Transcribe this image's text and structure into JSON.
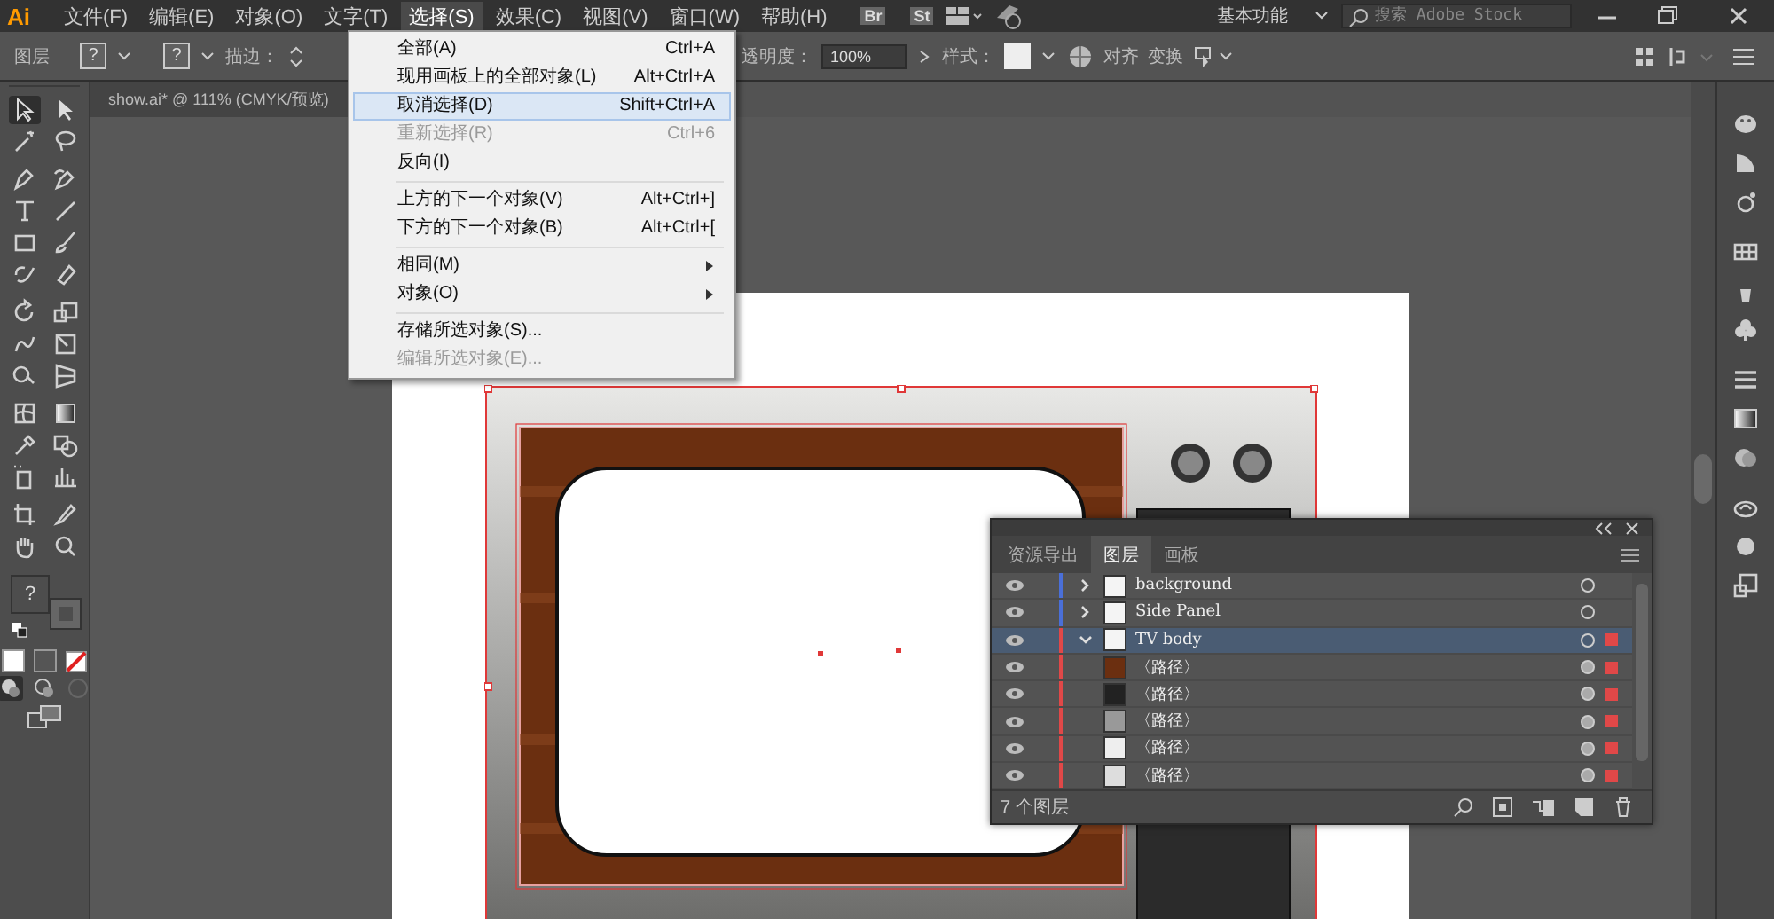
{
  "menu_bar": {
    "logo": "Ai",
    "items": [
      {
        "label": "文件(F)",
        "selected": false
      },
      {
        "label": "编辑(E)",
        "selected": false
      },
      {
        "label": "对象(O)",
        "selected": false
      },
      {
        "label": "文字(T)",
        "selected": false
      },
      {
        "label": "选择(S)",
        "selected": true
      },
      {
        "label": "效果(C)",
        "selected": false
      },
      {
        "label": "视图(V)",
        "selected": false
      },
      {
        "label": "窗口(W)",
        "selected": false
      },
      {
        "label": "帮助(H)",
        "selected": false
      }
    ],
    "bridge": "Br",
    "stock": "St",
    "workspace": "基本功能",
    "search": {
      "placeholder": "搜索 Adobe Stock"
    }
  },
  "control_bar": {
    "selection_label": "图层",
    "fill_swatch": "?",
    "stroke_swatch": "?",
    "stroke_label": "描边：",
    "opacity_label": "透明度：",
    "opacity": "100%",
    "style_label": "样式：",
    "align": "对齐",
    "transform": "变换"
  },
  "document_tab": {
    "title": "show.ai* @ 111% (CMYK/预览)"
  },
  "select_menu": {
    "groups": [
      [
        {
          "label": "全部(A)",
          "shortcut": "Ctrl+A",
          "disabled": false,
          "submenu": false,
          "selected": false
        },
        {
          "label": "现用画板上的全部对象(L)",
          "shortcut": "Alt+Ctrl+A",
          "disabled": false,
          "submenu": false,
          "selected": false
        },
        {
          "label": "取消选择(D)",
          "shortcut": "Shift+Ctrl+A",
          "disabled": false,
          "submenu": false,
          "selected": true
        },
        {
          "label": "重新选择(R)",
          "shortcut": "Ctrl+6",
          "disabled": true,
          "submenu": false,
          "selected": false
        },
        {
          "label": "反向(I)",
          "disabled": false,
          "submenu": false,
          "selected": false
        }
      ],
      [
        {
          "label": "上方的下一个对象(V)",
          "shortcut": "Alt+Ctrl+]",
          "disabled": false,
          "submenu": false,
          "selected": false
        },
        {
          "label": "下方的下一个对象(B)",
          "shortcut": "Alt+Ctrl+[",
          "disabled": false,
          "submenu": false,
          "selected": false
        }
      ],
      [
        {
          "label": "相同(M)",
          "disabled": false,
          "submenu": true,
          "selected": false
        },
        {
          "label": "对象(O)",
          "disabled": false,
          "submenu": true,
          "selected": false
        }
      ],
      [
        {
          "label": "存储所选对象(S)...",
          "disabled": false,
          "submenu": false,
          "selected": false
        },
        {
          "label": "编辑所选对象(E)...",
          "disabled": true,
          "submenu": false,
          "selected": false
        }
      ]
    ]
  },
  "toolbar": {
    "fill_swatch": "?"
  },
  "layers_panel": {
    "tabs": [
      {
        "label": "资源导出",
        "selected": false
      },
      {
        "label": "图层",
        "selected": true
      },
      {
        "label": "画板",
        "selected": false
      }
    ],
    "layers": [
      {
        "name": "background",
        "color": "#4a6fd8",
        "expanded": false,
        "selected": false,
        "art_selected": false
      },
      {
        "name": "Side Panel",
        "color": "#4a6fd8",
        "expanded": false,
        "selected": false,
        "art_selected": false
      },
      {
        "name": "TV body",
        "color": "#e04848",
        "expanded": true,
        "selected": true,
        "art_selected": true,
        "children": [
          {
            "name": "〈路径〉",
            "art_selected": true
          },
          {
            "name": "〈路径〉",
            "art_selected": true
          },
          {
            "name": "〈路径〉",
            "art_selected": true
          },
          {
            "name": "〈路径〉",
            "art_selected": true
          },
          {
            "name": "〈路径〉",
            "art_selected": true
          }
        ]
      }
    ],
    "footer": "7 个图层"
  }
}
